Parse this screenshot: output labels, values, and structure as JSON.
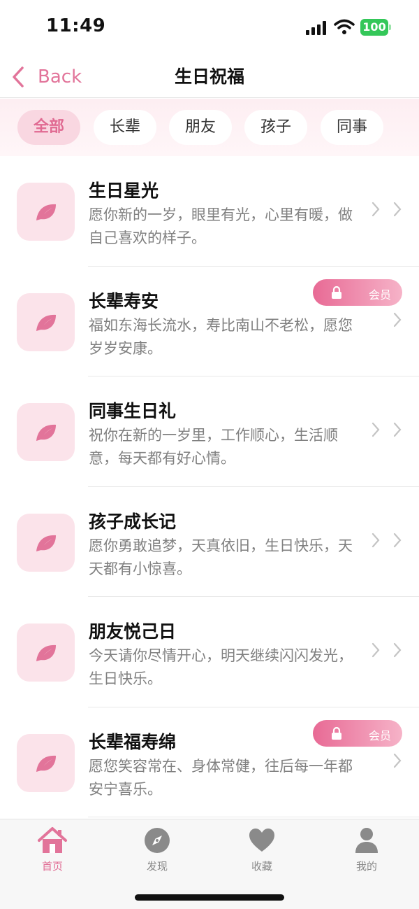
{
  "status_bar": {
    "time": "11:49",
    "battery": "100"
  },
  "nav": {
    "back_label": "Back",
    "title": "生日祝福"
  },
  "filters": [
    {
      "label": "全部",
      "active": true
    },
    {
      "label": "长辈",
      "active": false
    },
    {
      "label": "朋友",
      "active": false
    },
    {
      "label": "孩子",
      "active": false
    },
    {
      "label": "同事",
      "active": false
    }
  ],
  "items": [
    {
      "title": "生日星光",
      "desc": "愿你新的一岁，眼里有光，心里有暖，做自己喜欢的样子。",
      "vip": false
    },
    {
      "title": "长辈寿安",
      "desc": "福如东海长流水，寿比南山不老松，愿您岁岁安康。",
      "vip": true,
      "vip_label": "会员"
    },
    {
      "title": "同事生日礼",
      "desc": "祝你在新的一岁里，工作顺心，生活顺意，每天都有好心情。",
      "vip": false
    },
    {
      "title": "孩子成长记",
      "desc": "愿你勇敢追梦，天真依旧，生日快乐，天天都有小惊喜。",
      "vip": false
    },
    {
      "title": "朋友悦己日",
      "desc": "今天请你尽情开心，明天继续闪闪发光，生日快乐。",
      "vip": false
    },
    {
      "title": "长辈福寿绵",
      "desc": "愿您笑容常在、身体常健，往后每一年都安宁喜乐。",
      "vip": true,
      "vip_label": "会员"
    }
  ],
  "tab_bar": [
    {
      "label": "首页",
      "icon": "home-icon",
      "active": true
    },
    {
      "label": "发现",
      "icon": "compass-icon",
      "active": false
    },
    {
      "label": "收藏",
      "icon": "heart-icon",
      "active": false
    },
    {
      "label": "我的",
      "icon": "person-icon",
      "active": false
    }
  ],
  "colors": {
    "accent": "#e2749a",
    "thumb_bg": "#fbe3ea",
    "chip_active_bg": "#f9d7e1"
  }
}
